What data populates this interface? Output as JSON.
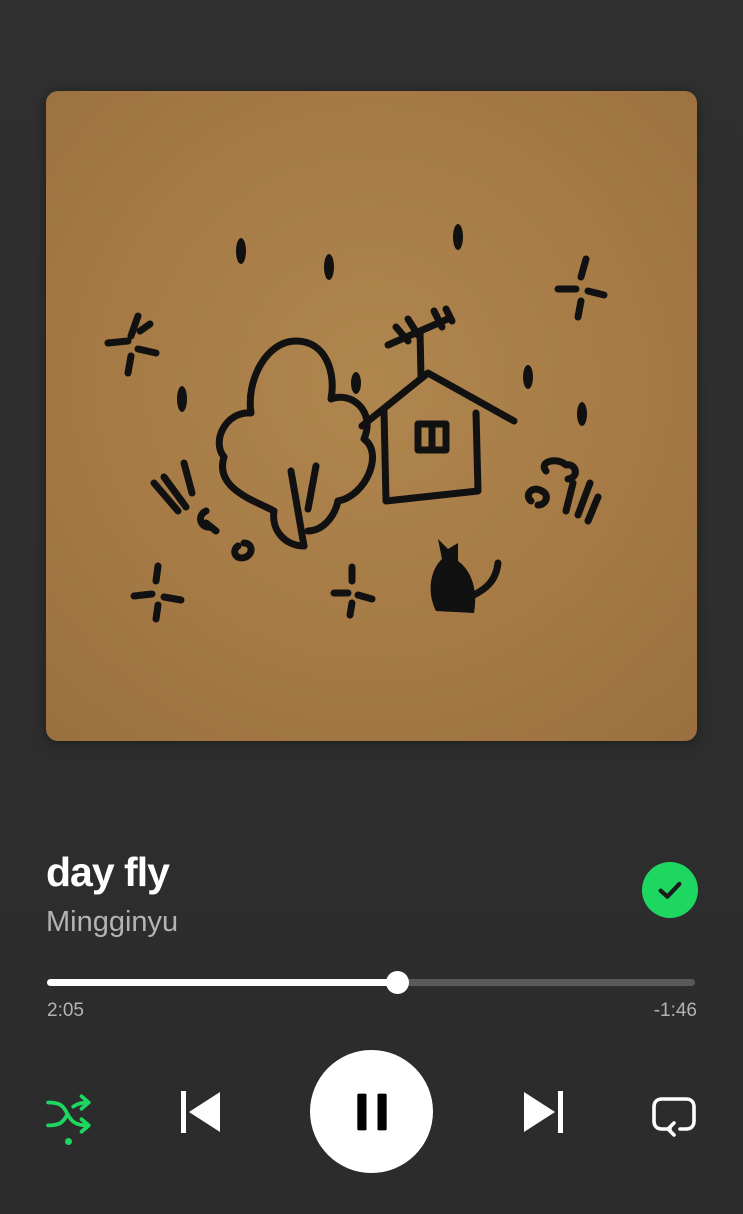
{
  "album_art": {
    "alt": "day fly cover art"
  },
  "track": {
    "title": "day fly",
    "artist": "Mingginyu",
    "liked": true
  },
  "playback": {
    "elapsed": "2:05",
    "remaining": "-1:46",
    "progress_fraction": 0.54,
    "is_playing": true,
    "shuffle_on": true,
    "repeat_on": false
  },
  "icons": {
    "liked": "check-circle-icon",
    "shuffle": "shuffle-icon",
    "previous": "skip-previous-icon",
    "play_pause": "pause-icon",
    "next": "skip-next-icon",
    "repeat": "repeat-icon"
  },
  "colors": {
    "background": "#2d2d2d",
    "accent": "#1ed760",
    "primary_text": "#ffffff",
    "secondary_text": "#b3b3b3",
    "track": "#5a5a5a"
  }
}
